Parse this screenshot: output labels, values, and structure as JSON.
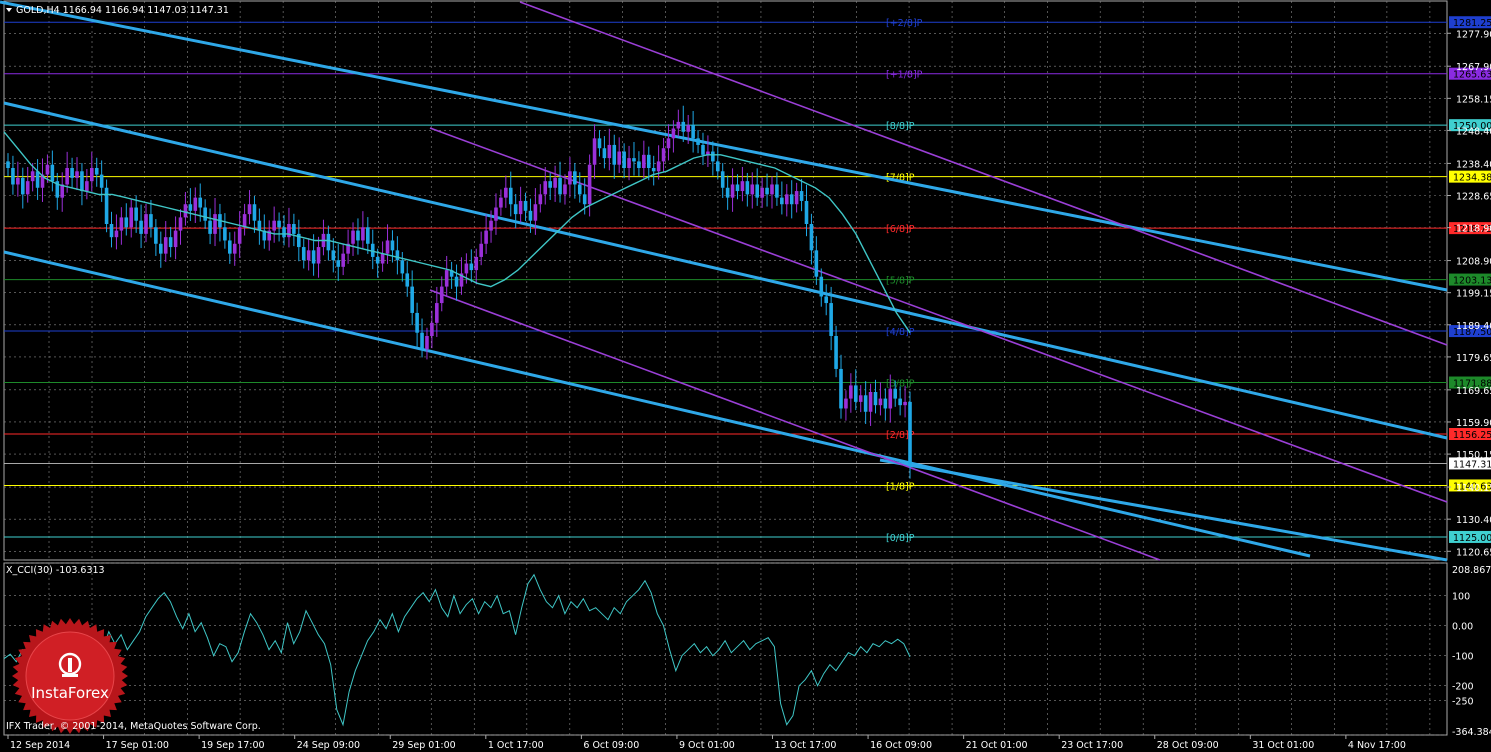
{
  "header": {
    "symbol_title": "GOLD,H4  1166.94 1166.94 1147.03 1147.31",
    "cci_title": "X_CCI(30) -103.6313",
    "copyright": "IFX Trader, © 2001-2014, MetaQuotes Software Corp."
  },
  "logo": {
    "text": "InstaForex"
  },
  "colors": {
    "background": "#000000",
    "grid": "#8a8a8a",
    "bull_candle": "#9b30d9",
    "bear_candle": "#1fa8e6",
    "ma_line": "#3fc6c6",
    "channel_thick": "#2fa8e8",
    "channel_thin": "#9a3fd6",
    "cci_line": "#3fc6c6"
  },
  "chart_data": [
    {
      "type": "candlestick",
      "symbol": "GOLD",
      "timeframe": "H4",
      "ohlc_last": {
        "open": 1166.94,
        "high": 1166.94,
        "low": 1147.03,
        "close": 1147.31
      },
      "ylim": [
        1118,
        1288
      ],
      "y_ticks": [
        "1277.90",
        "1267.90",
        "1258.15",
        "1248.40",
        "1238.40",
        "1228.65",
        "1218.90",
        "1208.90",
        "1199.15",
        "1189.40",
        "1179.65",
        "1169.65",
        "1159.90",
        "1150.15",
        "1140.15",
        "1130.40",
        "1120.65"
      ],
      "x_ticks": [
        "12 Sep 2014",
        "17 Sep 01:00",
        "19 Sep 17:00",
        "24 Sep 09:00",
        "29 Sep 01:00",
        "1 Oct 17:00",
        "6 Oct 09:00",
        "9 Oct 01:00",
        "13 Oct 17:00",
        "16 Oct 09:00",
        "21 Oct 01:00",
        "23 Oct 17:00",
        "28 Oct 09:00",
        "31 Oct 01:00",
        "4 Nov 17:00"
      ],
      "murrey_levels": [
        {
          "label": "[+2/8]P",
          "value": 1281.25,
          "tag": "1281.25",
          "color": "#1e3fd0",
          "tag_bg": "#1e3fd0"
        },
        {
          "label": "[+1/8]P",
          "value": 1265.63,
          "tag": "1265.63",
          "color": "#8a2be2",
          "tag_bg": "#8a2be2"
        },
        {
          "label": "[8/8]P",
          "value": 1250.0,
          "tag": "1250.00",
          "color": "#3fd0d0",
          "tag_bg": "#3fd0d0"
        },
        {
          "label": "[7/8]P",
          "value": 1234.38,
          "tag": "1234.38",
          "color": "#ffff00",
          "tag_bg": "#ffff00"
        },
        {
          "label": "[6/8]P",
          "value": 1218.75,
          "tag": "1218.75",
          "color": "#ff2a2a",
          "tag_bg": "#ff2a2a"
        },
        {
          "label": "[5/8]P",
          "value": 1203.13,
          "tag": "1203.13",
          "color": "#1d8a2a",
          "tag_bg": "#1d8a2a"
        },
        {
          "label": "[4/8]P",
          "value": 1187.5,
          "tag": "1187.50",
          "color": "#1e3fd0",
          "tag_bg": "#1e3fd0"
        },
        {
          "label": "[3/8]P",
          "value": 1171.88,
          "tag": "1171.88",
          "color": "#1d8a2a",
          "tag_bg": "#1d8a2a"
        },
        {
          "label": "[2/8]P",
          "value": 1156.25,
          "tag": "1156.25",
          "color": "#ff2a2a",
          "tag_bg": "#ff2a2a"
        },
        {
          "label": "[1/8]P",
          "value": 1140.63,
          "tag": "1140.63",
          "color": "#ffff00",
          "tag_bg": "#ffff00"
        },
        {
          "label": "[0/8]P",
          "value": 1125.0,
          "tag": "1125.00",
          "color": "#3fd0d0",
          "tag_bg": "#3fd0d0"
        }
      ],
      "current_price": {
        "value": 1147.31,
        "tag": "1147.31"
      },
      "close_series": [
        1237,
        1232,
        1234,
        1229,
        1233,
        1236,
        1231,
        1235,
        1238,
        1233,
        1228,
        1232,
        1237,
        1234,
        1236,
        1230,
        1233,
        1237,
        1235,
        1231,
        1220,
        1216,
        1218,
        1222,
        1219,
        1225,
        1221,
        1217,
        1223,
        1219,
        1214,
        1211,
        1216,
        1213,
        1218,
        1222,
        1226,
        1224,
        1228,
        1225,
        1221,
        1217,
        1223,
        1219,
        1215,
        1211,
        1214,
        1219,
        1223,
        1226,
        1221,
        1218,
        1215,
        1218,
        1221,
        1219,
        1216,
        1220,
        1217,
        1213,
        1209,
        1212,
        1208,
        1213,
        1217,
        1212,
        1209,
        1207,
        1211,
        1214,
        1218,
        1215,
        1219,
        1214,
        1210,
        1208,
        1211,
        1215,
        1212,
        1209,
        1205,
        1201,
        1193,
        1187,
        1182,
        1186,
        1190,
        1196,
        1201,
        1206,
        1204,
        1201,
        1205,
        1208,
        1206,
        1210,
        1214,
        1218,
        1221,
        1225,
        1228,
        1231,
        1226,
        1223,
        1227,
        1224,
        1221,
        1226,
        1229,
        1233,
        1231,
        1234,
        1229,
        1232,
        1236,
        1232,
        1229,
        1226,
        1238,
        1246,
        1243,
        1240,
        1244,
        1238,
        1242,
        1237,
        1240,
        1239,
        1237,
        1241,
        1237,
        1236,
        1239,
        1243,
        1246,
        1249,
        1251,
        1248,
        1250,
        1246,
        1244,
        1241,
        1242,
        1239,
        1236,
        1231,
        1228,
        1232,
        1230,
        1233,
        1229,
        1232,
        1228,
        1231,
        1229,
        1232,
        1228,
        1226,
        1229,
        1226,
        1230,
        1227,
        1220,
        1212,
        1204,
        1198,
        1196,
        1186,
        1176,
        1164,
        1167,
        1171,
        1166,
        1168,
        1163,
        1169,
        1165,
        1167,
        1164,
        1170,
        1167,
        1165,
        1166,
        1147
      ],
      "ma_series": [
        1248,
        1243,
        1238,
        1234,
        1232,
        1231,
        1230,
        1229,
        1229,
        1228,
        1227,
        1226,
        1225,
        1224,
        1223,
        1222,
        1221,
        1220,
        1219,
        1218,
        1217,
        1217,
        1216,
        1215,
        1215,
        1214,
        1213,
        1212,
        1211,
        1210,
        1209,
        1208,
        1207,
        1206,
        1204,
        1202,
        1201,
        1203,
        1206,
        1210,
        1214,
        1218,
        1222,
        1225,
        1227,
        1229,
        1231,
        1233,
        1235,
        1236,
        1238,
        1240,
        1241,
        1241,
        1240,
        1239,
        1238,
        1237,
        1235,
        1233,
        1231,
        1228,
        1223,
        1217,
        1209,
        1201,
        1193,
        1187
      ],
      "cci": {
        "ylim": [
          -364.3846,
          208.8672
        ],
        "y_ticks": [
          "208.8672",
          "100",
          "0.00",
          "-100",
          "-200",
          "-250",
          "-364.3846"
        ],
        "last": -103.6313,
        "values": [
          -110,
          -95,
          -120,
          -80,
          -100,
          -60,
          -130,
          -90,
          -70,
          -110,
          -60,
          -120,
          -40,
          -90,
          -150,
          -40,
          -80,
          -20,
          -60,
          -30,
          -80,
          -50,
          -20,
          30,
          60,
          90,
          110,
          80,
          30,
          -10,
          40,
          -20,
          10,
          -40,
          -100,
          -60,
          -70,
          -120,
          -90,
          -20,
          40,
          10,
          -30,
          -80,
          -50,
          -90,
          10,
          -60,
          -20,
          50,
          10,
          -30,
          -60,
          -130,
          -280,
          -330,
          -220,
          -150,
          -100,
          -50,
          -20,
          20,
          -10,
          40,
          -20,
          30,
          60,
          90,
          110,
          80,
          120,
          60,
          30,
          100,
          40,
          70,
          90,
          40,
          80,
          60,
          100,
          40,
          50,
          -30,
          60,
          140,
          170,
          120,
          80,
          60,
          100,
          40,
          80,
          60,
          90,
          50,
          60,
          40,
          20,
          60,
          40,
          80,
          100,
          120,
          150,
          110,
          40,
          0,
          -80,
          -150,
          -100,
          -80,
          -60,
          -90,
          -70,
          -100,
          -80,
          -50,
          -90,
          -70,
          -50,
          -80,
          -60,
          -50,
          -40,
          -70,
          -260,
          -330,
          -300,
          -200,
          -180,
          -150,
          -200,
          -160,
          -130,
          -150,
          -120,
          -90,
          -100,
          -70,
          -90,
          -60,
          -70,
          -50,
          -60,
          -45,
          -60,
          -104
        ]
      }
    }
  ]
}
